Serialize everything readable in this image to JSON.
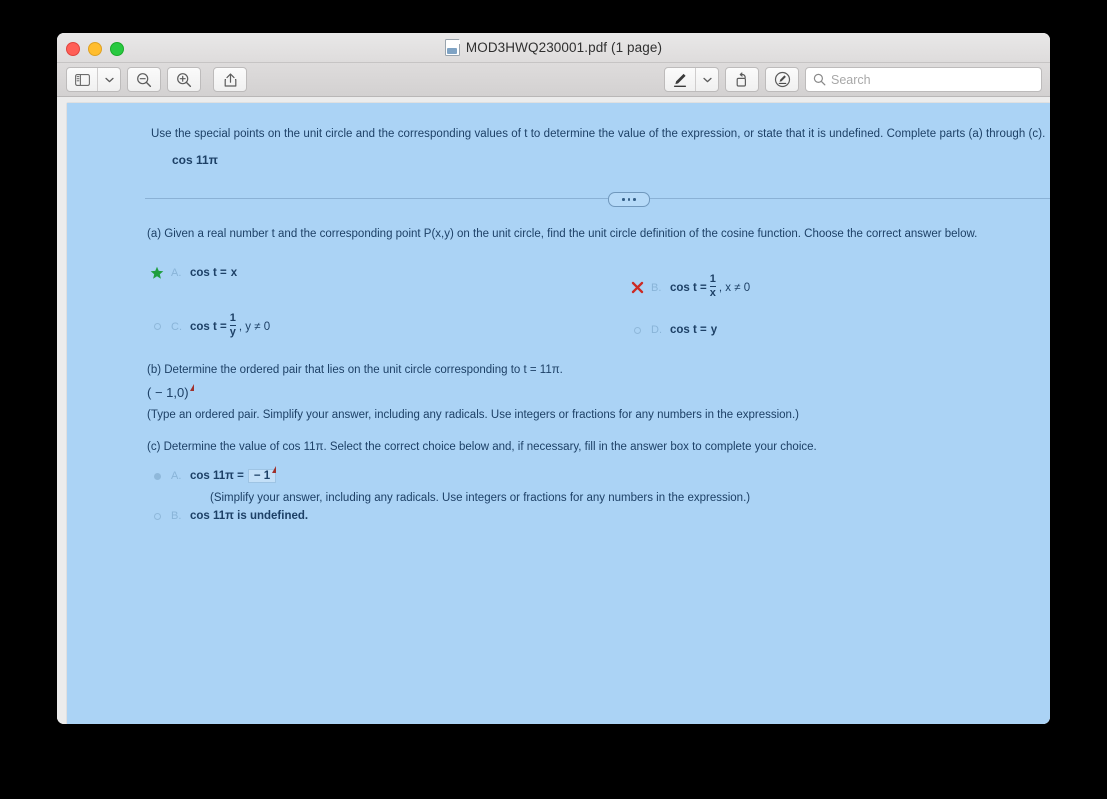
{
  "window": {
    "title": "MOD3HWQ230001.pdf (1 page)",
    "doc_icon": "pdf-document-icon",
    "traffic_lights": {
      "close": "close-window-button",
      "minimize": "minimize-window-button",
      "zoom": "zoom-window-button"
    }
  },
  "toolbar": {
    "sidebar_button": "sidebar-toggle",
    "sidebar_chevron": "chevron-down-icon",
    "zoom_out": "zoom-out-icon",
    "zoom_in": "zoom-in-icon",
    "share": "share-icon",
    "markup": "markup-pen-icon",
    "markup_chevron": "chevron-down-icon",
    "rotate": "rotate-icon",
    "annotate": "annotate-icon",
    "search_placeholder": "Search",
    "search_value": ""
  },
  "document": {
    "prompt": "Use the special points on the unit circle and the corresponding values of t to determine the value of the expression, or state that it is undefined. Complete parts (a) through (c).",
    "expression": "cos 11π",
    "divider_pill": "expand-section-ellipsis",
    "part_a": {
      "text": "(a) Given a real number t and the corresponding point P(x,y) on the unit circle, find the unit circle definition of the cosine function. Choose the correct answer below.",
      "options": [
        {
          "letter": "A.",
          "marker": "correct-star",
          "lhs": "cos t =",
          "rhs": "x",
          "fraction": null,
          "condition": ""
        },
        {
          "letter": "B.",
          "marker": "incorrect-x",
          "lhs": "cos t =",
          "rhs": "",
          "fraction": {
            "numerator": "1",
            "denominator": "x"
          },
          "condition": ", x ≠ 0"
        },
        {
          "letter": "C.",
          "marker": "radio",
          "lhs": "cos t =",
          "rhs": "",
          "fraction": {
            "numerator": "1",
            "denominator": "y"
          },
          "condition": ", y ≠ 0"
        },
        {
          "letter": "D.",
          "marker": "radio",
          "lhs": "cos t =",
          "rhs": "y",
          "fraction": null,
          "condition": ""
        }
      ]
    },
    "part_b": {
      "text": "(b) Determine the ordered pair that lies on the unit circle corresponding to t = 11π.",
      "answer": "( − 1,0)",
      "note": "(Type an ordered pair. Simplify your answer, including any radicals. Use integers or fractions for any numbers in the expression.)"
    },
    "part_c": {
      "text": "(c) Determine the value of cos 11π. Select the correct choice below and, if necessary, fill in the answer box to complete your choice.",
      "options": [
        {
          "letter": "A.",
          "marker": "radio-selected",
          "lhs": "cos 11π =",
          "answer_box": "− 1"
        },
        {
          "letter": "B.",
          "marker": "radio",
          "lhs": "cos 11π is undefined.",
          "answer_box": null
        }
      ],
      "note": "(Simplify your answer, including any radicals. Use integers or fractions for any numbers in the expression.)"
    }
  },
  "colors": {
    "page_background": "#abd3f5",
    "text": "#1d4066",
    "correct_marker": "#1f9e3e",
    "incorrect_marker": "#cc2a24",
    "window_chrome": "#dedcdc"
  }
}
